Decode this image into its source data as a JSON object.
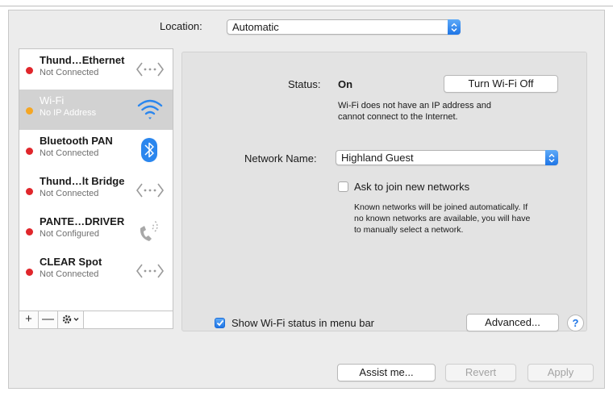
{
  "location": {
    "label": "Location:",
    "value": "Automatic"
  },
  "services": [
    {
      "name": "Thund…Ethernet",
      "status": "Not Connected",
      "dot_color": "#e0262b",
      "icon": "ethernet-arrows-icon",
      "selected": false
    },
    {
      "name": "Wi-Fi",
      "status": "No IP Address",
      "dot_color": "#f5a623",
      "icon": "wifi-icon",
      "selected": true
    },
    {
      "name": "Bluetooth PAN",
      "status": "Not Connected",
      "dot_color": "#e0262b",
      "icon": "bluetooth-icon",
      "selected": false
    },
    {
      "name": "Thund…lt Bridge",
      "status": "Not Connected",
      "dot_color": "#e0262b",
      "icon": "ethernet-arrows-icon",
      "selected": false
    },
    {
      "name": "PANTE…DRIVER",
      "status": "Not Configured",
      "dot_color": "#e0262b",
      "icon": "phone-icon",
      "selected": false
    },
    {
      "name": "CLEAR Spot",
      "status": "Not Connected",
      "dot_color": "#e0262b",
      "icon": "ethernet-arrows-icon",
      "selected": false
    }
  ],
  "sidebar_toolbar": {
    "add": "+",
    "remove": "—"
  },
  "wifi": {
    "status_label": "Status:",
    "status_value": "On",
    "turn_off_button": "Turn Wi-Fi Off",
    "status_desc_line1": "Wi-Fi does not have an IP address and",
    "status_desc_line2": "cannot connect to the Internet.",
    "network_name_label": "Network Name:",
    "network_name_value": "Highland Guest",
    "ask_join_label": "Ask to join new networks",
    "ask_join_checked": false,
    "ask_desc_line1": "Known networks will be joined automatically. If",
    "ask_desc_line2": "no known networks are available, you will have",
    "ask_desc_line3": "to manually select a network.",
    "show_status_label": "Show Wi-Fi status in menu bar",
    "show_status_checked": true,
    "advanced_button": "Advanced...",
    "help_button": "?"
  },
  "footer": {
    "assist_button": "Assist me...",
    "revert_button": "Revert",
    "apply_button": "Apply"
  },
  "colors": {
    "accent": "#1e75e6",
    "selected_row": "#d2d2d2",
    "status_red": "#e0262b",
    "status_amber": "#f5a623"
  }
}
